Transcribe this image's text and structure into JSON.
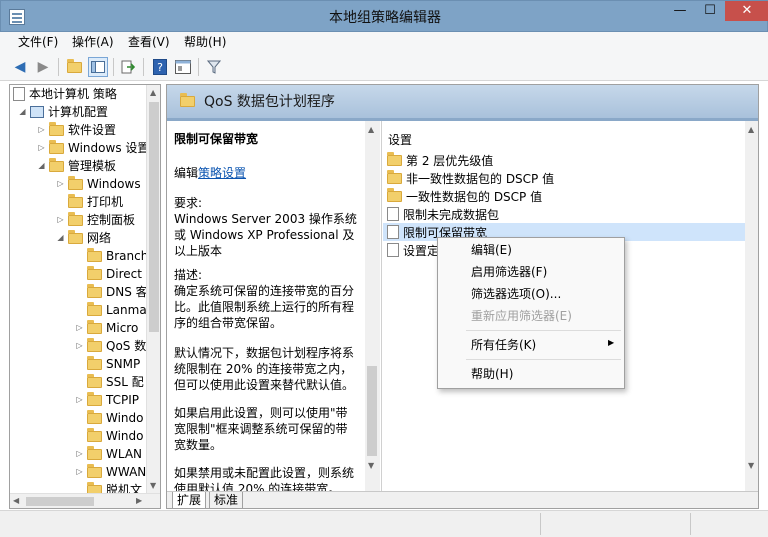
{
  "window": {
    "title": "本地组策略编辑器",
    "minimize": "—",
    "maximize": "☐",
    "close": "✕"
  },
  "menu": {
    "file": "文件(F)",
    "action": "操作(A)",
    "view": "查看(V)",
    "help": "帮助(H)"
  },
  "toolbar": {
    "back": "◀",
    "forward": "▶"
  },
  "tree": {
    "items": [
      "本地计算机 策略",
      "计算机配置",
      "软件设置",
      "Windows 设置",
      "管理模板",
      "Windows",
      "打印机",
      "控制面板",
      "网络",
      "Branch",
      "Direct",
      "DNS 客",
      "Lanma",
      "Micro",
      "QoS 数",
      "SNMP",
      "SSL 配",
      "TCPIP",
      "Windo",
      "Windo",
      "WLAN",
      "WWAN",
      "脱机文"
    ]
  },
  "pane": {
    "title": "QoS 数据包计划程序"
  },
  "description": {
    "title": "限制可保留带宽",
    "edit_prefix": "编辑",
    "edit_link": "策略设置",
    "req_label": "要求:",
    "req_text": "Windows Server 2003 操作系统或 Windows XP Professional 及以上版本",
    "desc_label": "描述:",
    "p1": "确定系统可保留的连接带宽的百分比。此值限制系统上运行的所有程序的组合带宽保留。",
    "p2": "默认情况下，数据包计划程序将系统限制在 20% 的连接带宽之内，但可以使用此设置来替代默认值。",
    "p3": "如果启用此设置，则可以使用\"带宽限制\"框来调整系统可保留的带宽数量。",
    "p4": "如果禁用或未配置此设置，则系统使用默认值 20% 的连接带宽。"
  },
  "list": {
    "header": "设置",
    "rows": [
      "第 2 层优先级值",
      "非一致性数据包的 DSCP 值",
      "一致性数据包的 DSCP 值",
      "限制未完成数据包",
      "限制可保留带宽",
      "设置定"
    ]
  },
  "tabs": {
    "expand": "扩展",
    "standard": "标准"
  },
  "context_menu": {
    "edit": "编辑(E)",
    "enable_filter": "启用筛选器(F)",
    "filter_options": "筛选器选项(O)...",
    "reapply_filter": "重新应用筛选器(E)",
    "all_tasks": "所有任务(K)",
    "help": "帮助(H)"
  }
}
